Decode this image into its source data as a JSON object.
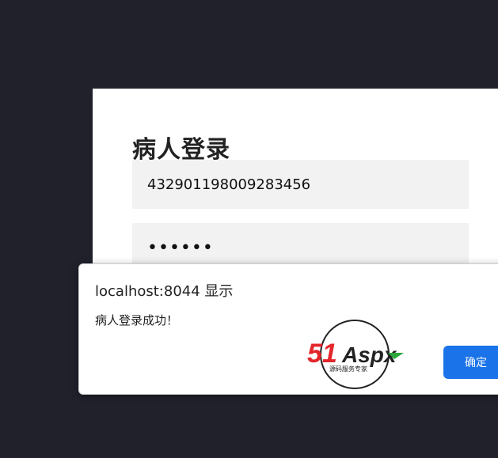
{
  "login": {
    "title": "病人登录",
    "id_value": "432901198009283456",
    "password_value": "••••••"
  },
  "alert": {
    "title": "localhost:8044 显示",
    "message": "病人登录成功！",
    "ok_label": "确定"
  },
  "watermark": {
    "brand_left": "51",
    "brand_right": "Aspx",
    "tagline": "源码服务专家"
  },
  "colors": {
    "background": "#20212b",
    "accent": "#1a73e8",
    "watermark_red": "#e3262b",
    "watermark_green": "#2aa63a"
  }
}
